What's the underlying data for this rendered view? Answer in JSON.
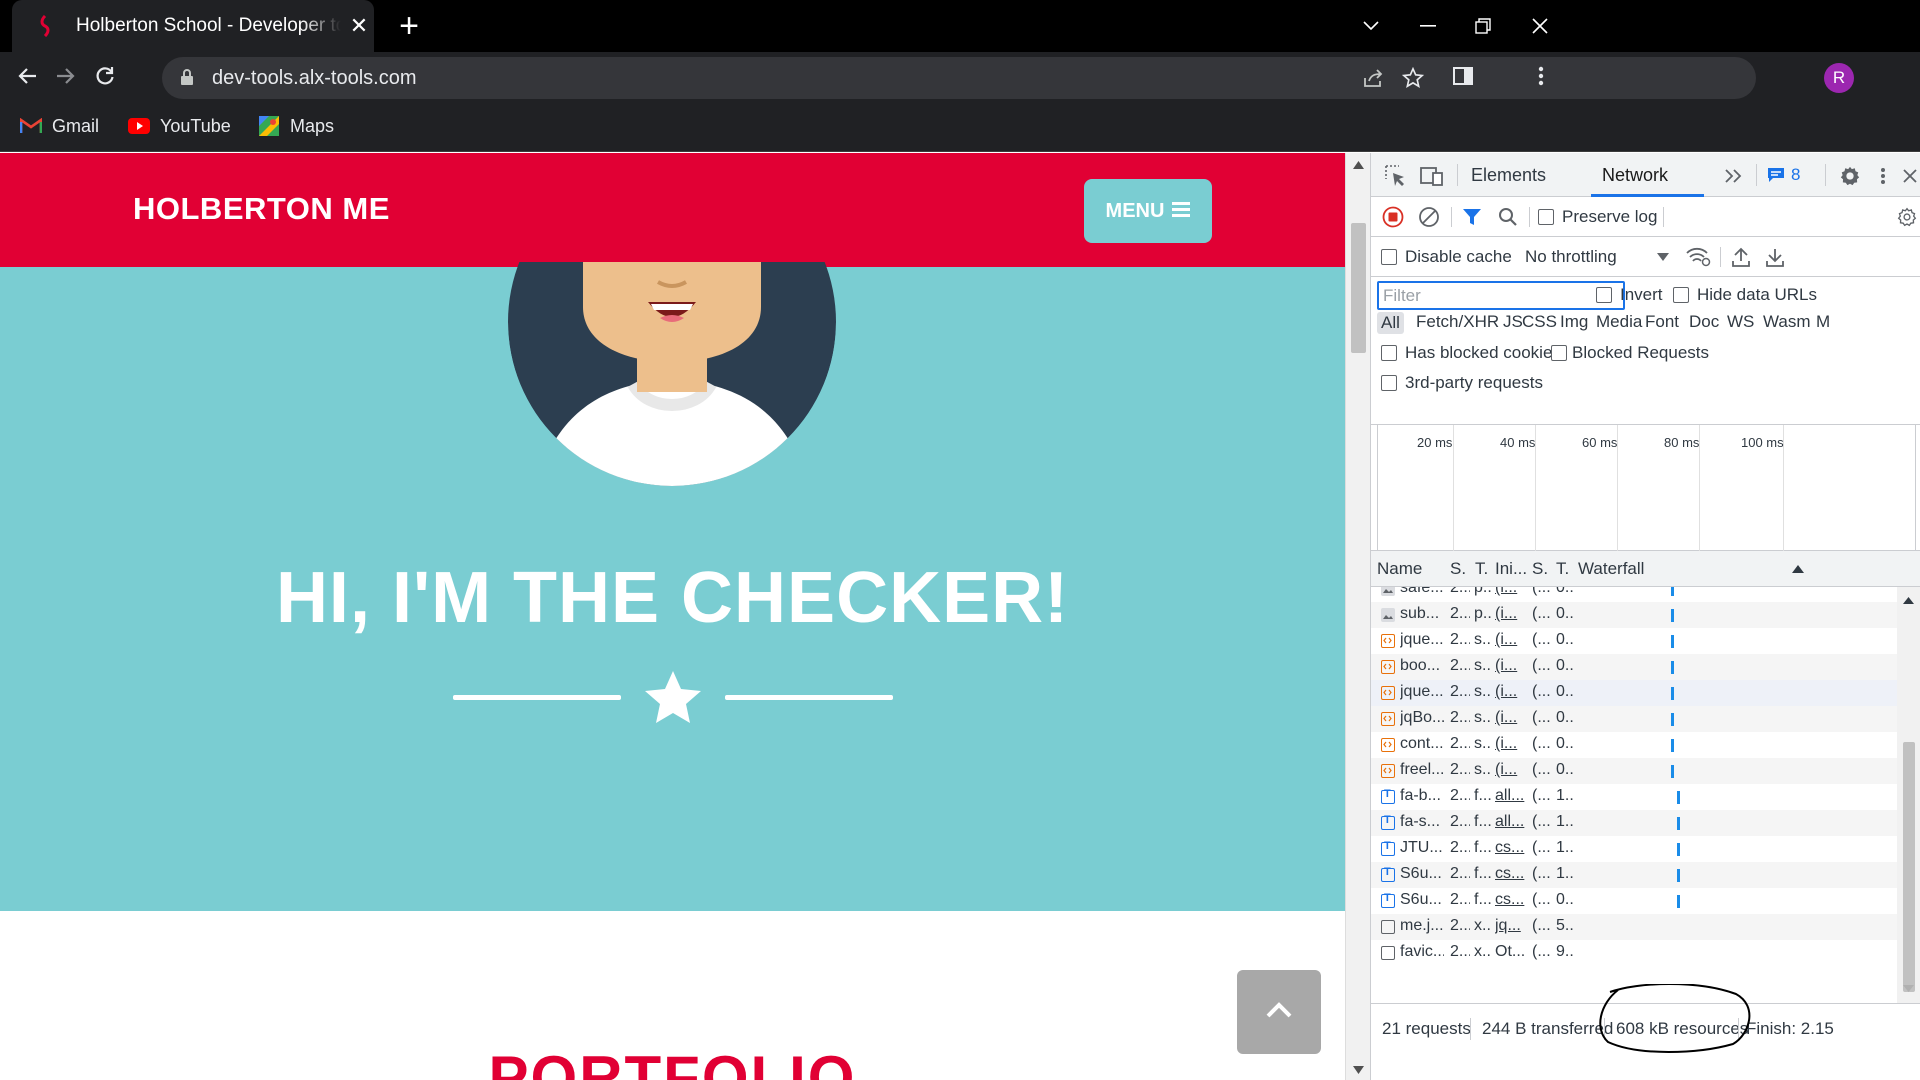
{
  "browser": {
    "tab_title": "Holberton School - Developer tools",
    "url": "dev-tools.alx-tools.com",
    "avatar_letter": "R",
    "bookmarks": [
      {
        "label": "Gmail",
        "icon": "gmail-icon"
      },
      {
        "label": "YouTube",
        "icon": "youtube-icon"
      },
      {
        "label": "Maps",
        "icon": "maps-icon"
      }
    ]
  },
  "site": {
    "brand": "HOLBERTON ME",
    "menu_label": "MENU",
    "hero_title": "HI, I'M THE CHECKER!",
    "section_title": "PORTFOLIO",
    "colors": {
      "primary": "#e10034",
      "teal": "#7acdd2"
    }
  },
  "devtools": {
    "tabs": [
      "Elements",
      "Network"
    ],
    "active_tab": "Network",
    "issues_count": "8",
    "preserve_log": "Preserve log",
    "disable_cache": "Disable cache",
    "throttling": "No throttling",
    "filter_placeholder": "Filter",
    "invert": "Invert",
    "hide_data_urls": "Hide data URLs",
    "types": [
      "All",
      "Fetch/XHR",
      "JS",
      "CSS",
      "Img",
      "Media",
      "Font",
      "Doc",
      "WS",
      "Wasm",
      "M"
    ],
    "has_blocked_cookies": "Has blocked cookies",
    "blocked_requests": "Blocked Requests",
    "third_party": "3rd-party requests",
    "timeline_labels": [
      "20 ms",
      "40 ms",
      "60 ms",
      "80 ms",
      "100 ms"
    ],
    "columns": [
      "Name",
      "S.",
      "T.",
      "Ini...",
      "S.",
      "T.",
      "Waterfall"
    ],
    "rows": [
      {
        "name": "safe...",
        "s": "2...",
        "t": "p...",
        "ini": "(i...",
        "size": "(...",
        "time": "0...",
        "icon": "image",
        "link": true,
        "wf": 0.48
      },
      {
        "name": "sub...",
        "s": "2...",
        "t": "p...",
        "ini": "(i...",
        "size": "(...",
        "time": "0...",
        "icon": "image",
        "link": true,
        "wf": 0.48
      },
      {
        "name": "jque...",
        "s": "2...",
        "t": "s...",
        "ini": "(i...",
        "size": "(...",
        "time": "0...",
        "icon": "script",
        "link": true,
        "wf": 0.48
      },
      {
        "name": "boo...",
        "s": "2...",
        "t": "s...",
        "ini": "(i...",
        "size": "(...",
        "time": "0...",
        "icon": "script",
        "link": true,
        "wf": 0.48
      },
      {
        "name": "jque...",
        "s": "2...",
        "t": "s...",
        "ini": "(i...",
        "size": "(...",
        "time": "0...",
        "icon": "script",
        "link": true,
        "wf": 0.48
      },
      {
        "name": "jqBo...",
        "s": "2...",
        "t": "s...",
        "ini": "(i...",
        "size": "(...",
        "time": "0...",
        "icon": "script",
        "link": true,
        "wf": 0.48
      },
      {
        "name": "cont...",
        "s": "2...",
        "t": "s...",
        "ini": "(i...",
        "size": "(...",
        "time": "0...",
        "icon": "script",
        "link": true,
        "wf": 0.48
      },
      {
        "name": "freel...",
        "s": "2...",
        "t": "s...",
        "ini": "(i...",
        "size": "(...",
        "time": "0...",
        "icon": "script",
        "link": true,
        "wf": 0.48
      },
      {
        "name": "fa-b...",
        "s": "2...",
        "t": "f...",
        "ini": "all...",
        "size": "(...",
        "time": "1...",
        "icon": "font",
        "link": true,
        "wf": 0.51
      },
      {
        "name": "fa-s...",
        "s": "2...",
        "t": "f...",
        "ini": "all...",
        "size": "(...",
        "time": "1...",
        "icon": "font",
        "link": true,
        "wf": 0.51
      },
      {
        "name": "JTU...",
        "s": "2...",
        "t": "f...",
        "ini": "cs...",
        "size": "(...",
        "time": "1...",
        "icon": "font",
        "link": true,
        "wf": 0.51
      },
      {
        "name": "S6u...",
        "s": "2...",
        "t": "f...",
        "ini": "cs...",
        "size": "(...",
        "time": "1...",
        "icon": "font",
        "link": true,
        "wf": 0.51
      },
      {
        "name": "S6u...",
        "s": "2...",
        "t": "f...",
        "ini": "cs...",
        "size": "(...",
        "time": "0...",
        "icon": "font",
        "link": true,
        "wf": 0.51
      },
      {
        "name": "me.j...",
        "s": "2...",
        "t": "x...",
        "ini": "jq...",
        "size": "(...",
        "time": "5...",
        "icon": "doc",
        "link": true,
        "wf": null
      },
      {
        "name": "favic...",
        "s": "2...",
        "t": "x...",
        "ini": "Ot...",
        "size": "(...",
        "time": "9...",
        "icon": "doc",
        "link": false,
        "wf": null
      }
    ],
    "status": {
      "requests": "21 requests",
      "transferred": "244 B transferred",
      "resources": "608 kB resources",
      "finish": "Finish: 2.15"
    }
  }
}
